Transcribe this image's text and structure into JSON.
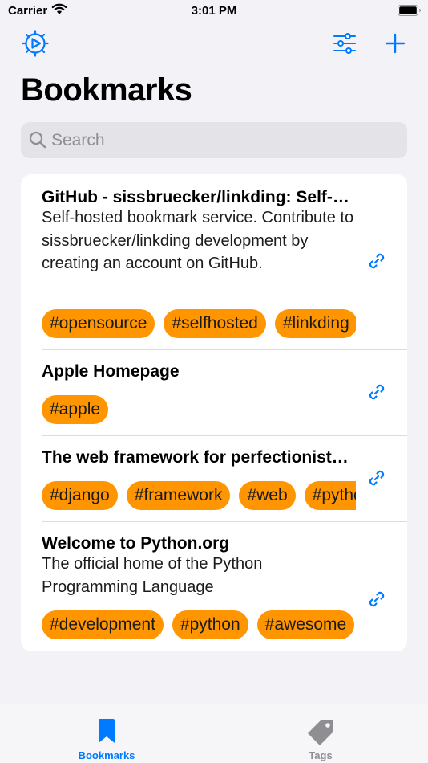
{
  "status_bar": {
    "carrier": "Carrier",
    "time": "3:01 PM"
  },
  "header": {
    "title": "Bookmarks"
  },
  "search": {
    "placeholder": "Search",
    "value": ""
  },
  "bookmarks": [
    {
      "title": "GitHub - sissbruecker/linkding: Self-hosted bookmark service",
      "description": "Self-hosted bookmark service. Contribute to sissbruecker/linkding development by creating an account on GitHub.",
      "tags": [
        "#opensource",
        "#selfhosted",
        "#linkding"
      ]
    },
    {
      "title": "Apple Homepage",
      "description": "",
      "tags": [
        "#apple"
      ]
    },
    {
      "title": "The web framework for perfectionists with deadlines",
      "description": "",
      "tags": [
        "#django",
        "#framework",
        "#web",
        "#python"
      ]
    },
    {
      "title": "Welcome to Python.org",
      "description": "The official home of the Python Programming Language",
      "tags": [
        "#development",
        "#python",
        "#awesome"
      ]
    }
  ],
  "tabbar": {
    "bookmarks_label": "Bookmarks",
    "tags_label": "Tags"
  },
  "colors": {
    "accent": "#007aff",
    "tag": "#ff9500",
    "inactive": "#8e8e93",
    "background": "#f2f2f7"
  }
}
